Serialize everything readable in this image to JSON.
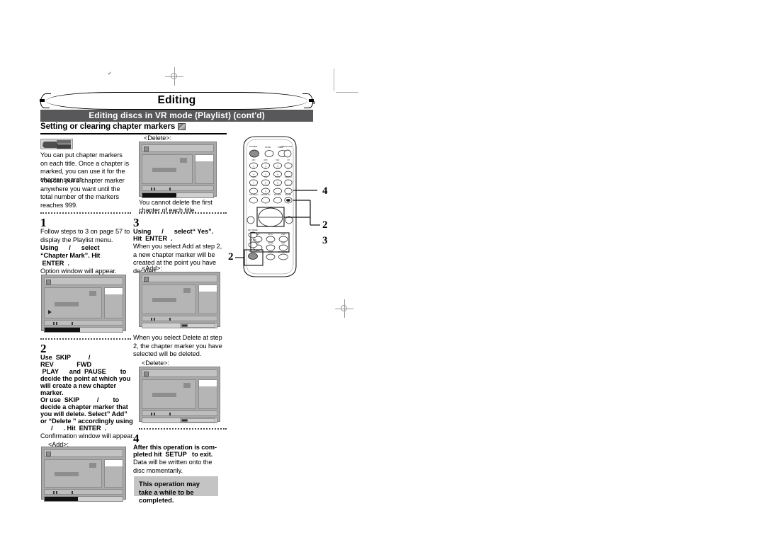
{
  "page": {
    "banner_title": "Editing",
    "section_bar": "Editing discs in VR mode (Playlist) (cont'd)",
    "subheading": "Setting or clearing chapter markers",
    "subheading_icon": "vr-mode-disc-icon"
  },
  "intro": {
    "disc_badge": "VR DVD-RW",
    "paragraph1": "You can put chapter markers on each title. Once a chapter is marked, you can use it for the chapter search.",
    "paragraph2": "You can put a chapter marker anywhere you want until the total number of the markers reaches 999."
  },
  "steps": {
    "step1": {
      "number": "1",
      "text_lead": "Follow steps  to 3 on page 57 to display the Playlist menu.",
      "bold_lines": [
        "Using      /      select",
        "“Chapter Mark”. Hit",
        " ENTER  ."
      ],
      "text_tail": "Option window will appear."
    },
    "step2": {
      "number": "2",
      "bold_lines": [
        "Use  SKIP          /",
        "REV             FWD",
        " PLAY      and  PAUSE        to",
        "decide the point at which you",
        "will create a new chapter",
        "marker.",
        "Or use  SKIP          /        to",
        "decide a chapter marker that",
        "you will delete. Select” Add”",
        "or “Delete ” accordingly using",
        "      /      . Hit  ENTER  ."
      ],
      "text_tail": "Confirmation window will appear.",
      "screen_label": "<Add>:"
    },
    "step3": {
      "number": "3",
      "bold_lines": [
        "Using      /      select“ Yes”.",
        "Hit  ENTER  ."
      ],
      "text_body": "When you select Add  at step 2, a new chapter marker will be created at the point you have decided.",
      "screen_label_add": "<Add>:",
      "text_body2": "When you select Delete  at step 2, the chapter marker you have selected will be deleted.",
      "screen_label_delete": "<Delete>:"
    },
    "step4": {
      "number": "4",
      "bold_lines": [
        "After this operation is com-",
        "pleted hit  SETUP   to exit."
      ],
      "text_tail": "Data will be written onto the disc momentarily.",
      "note": "This operation may take a while to be completed."
    }
  },
  "top_screen": {
    "label": "<Delete>:",
    "caption": "You cannot delete the first chapter of each title."
  },
  "remote": {
    "name": "remote-control-illustration",
    "labels": {
      "power": "POWER",
      "zoom": "ZOOM",
      "timer_prog": "TIMER PROG.",
      "open_close": "OPEN/CLOSE",
      "keys_row1": [
        "ABC 1",
        "ABC 2",
        "DEF 3",
        "CH +"
      ],
      "keys_row2": [
        "GHI 4",
        "JKL 5",
        "MNO 6",
        "CH -"
      ],
      "keys_row3": [
        "PQRS 7",
        "TUV 8",
        "WXYZ 9",
        "REPEAT"
      ],
      "keys_row4": [
        "DISPLAY",
        "SPACE 0",
        "CLEAR",
        "SETUP"
      ],
      "keys_row5": [
        "TOP MENU",
        "MENU/LIST",
        "RETURN",
        "ENTER"
      ],
      "transport_row1": [
        "REV",
        "PLAY",
        "FWD"
      ],
      "transport_row2": [
        "SKIP",
        "PAUSE",
        "SKIP"
      ],
      "transport_row3": [
        "STOP",
        "ON SCREEN"
      ],
      "left_buttons": [
        "REC SPEED",
        "SAT LINK",
        "REC/OTR"
      ]
    },
    "callouts": [
      {
        "number": "4",
        "points_to": "setup-button"
      },
      {
        "number": "2",
        "points_to": "direction-pad"
      },
      {
        "number": "3",
        "points_to": "enter-button"
      },
      {
        "number": "2",
        "points_to": "transport-buttons"
      }
    ]
  }
}
